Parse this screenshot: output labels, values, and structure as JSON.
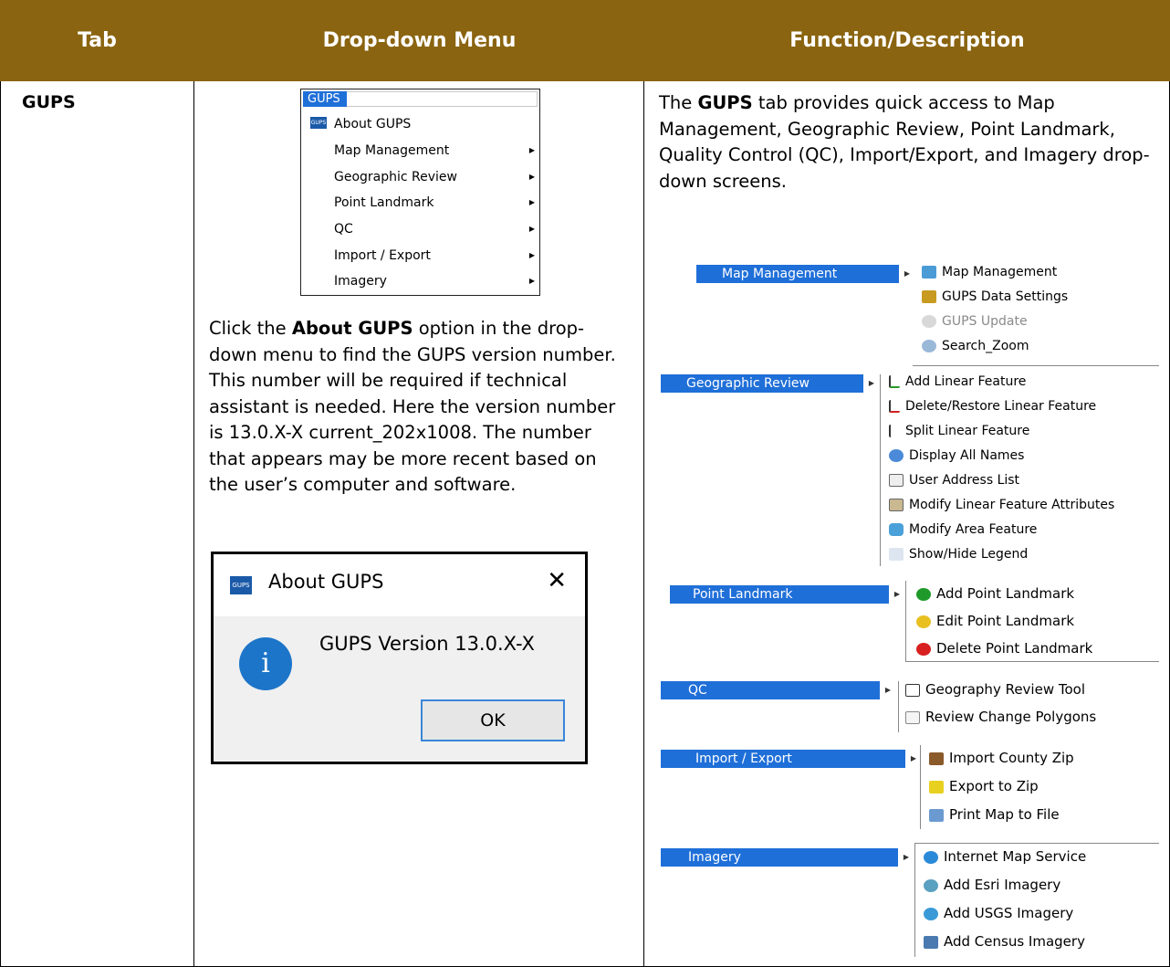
{
  "header": {
    "col1": "Tab",
    "col2": "Drop-down Menu",
    "col3": "Function/Description"
  },
  "row": {
    "tab": "GUPS",
    "dropdown": {
      "title": "GUPS",
      "items": [
        {
          "label": "About GUPS",
          "arrow": false
        },
        {
          "label": "Map Management",
          "arrow": true
        },
        {
          "label": "Geographic Review",
          "arrow": true
        },
        {
          "label": "Point Landmark",
          "arrow": true
        },
        {
          "label": "QC",
          "arrow": true
        },
        {
          "label": "Import / Export",
          "arrow": true
        },
        {
          "label": "Imagery",
          "arrow": true
        }
      ]
    },
    "about_text": {
      "before": "Click the ",
      "bold": "About GUPS",
      "after": " option in the drop-down menu to find the GUPS version number. This number will be required if technical assistant is needed. Here the version number is 13.0.X-X current_202x1008. The number that appears may be more recent based on the user’s computer and software."
    },
    "dialog": {
      "title": "About GUPS",
      "message": "GUPS Version 13.0.X-X",
      "ok": "OK",
      "close": "✕",
      "logo": "GUPS"
    },
    "description": {
      "before": "The ",
      "bold": "GUPS",
      "after": " tab provides quick access to Map Management, Geographic Review, Point Landmark, Quality Control (QC), Import/Export, and Imagery drop-down screens."
    },
    "menus": {
      "map_management": {
        "label": "Map Management",
        "items": [
          "Map Management",
          "GUPS Data Settings",
          "GUPS Update",
          "Search_Zoom"
        ]
      },
      "geographic_review": {
        "label": "Geographic Review",
        "items": [
          "Add Linear Feature",
          "Delete/Restore Linear Feature",
          "Split Linear Feature",
          "Display All Names",
          "User Address List",
          "Modify Linear Feature Attributes",
          "Modify Area Feature",
          "Show/Hide Legend"
        ]
      },
      "point_landmark": {
        "label": "Point Landmark",
        "items": [
          "Add Point Landmark",
          "Edit Point Landmark",
          "Delete Point Landmark"
        ]
      },
      "qc": {
        "label": "QC",
        "items": [
          "Geography Review Tool",
          "Review Change Polygons"
        ]
      },
      "import_export": {
        "label": "Import / Export",
        "items": [
          "Import County Zip",
          "Export to Zip",
          "Print Map to File"
        ]
      },
      "imagery": {
        "label": "Imagery",
        "items": [
          "Internet Map Service",
          "Add Esri Imagery",
          "Add USGS Imagery",
          "Add Census Imagery"
        ]
      }
    }
  },
  "colors": {
    "header_bg": "#8a6410",
    "menu_blue": "#1f6fd8"
  }
}
